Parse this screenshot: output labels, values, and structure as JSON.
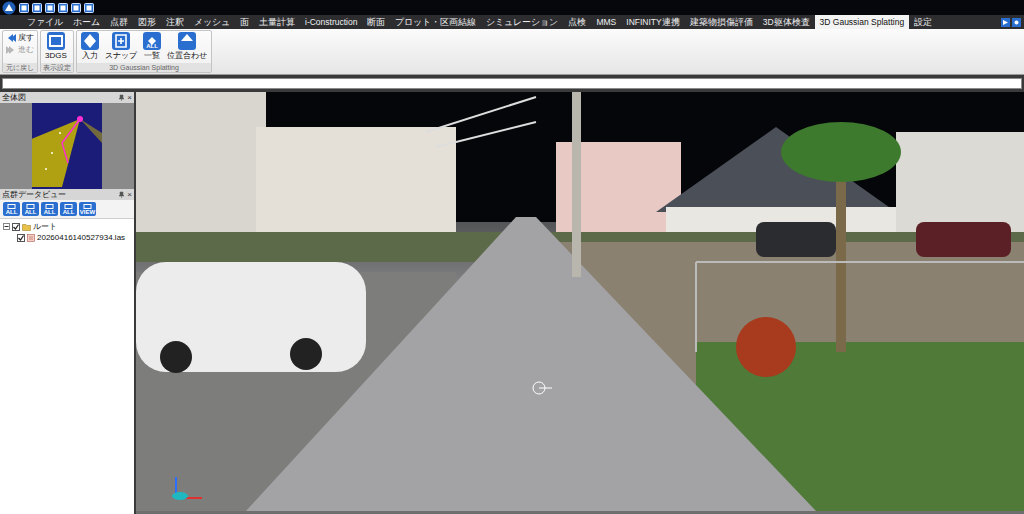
{
  "menu_tabs": [
    {
      "label": "ファイル",
      "selected": false
    },
    {
      "label": "ホーム",
      "selected": false
    },
    {
      "label": "点群",
      "selected": false
    },
    {
      "label": "図形",
      "selected": false
    },
    {
      "label": "注釈",
      "selected": false
    },
    {
      "label": "メッシュ",
      "selected": false
    },
    {
      "label": "面",
      "selected": false
    },
    {
      "label": "土量計算",
      "selected": false
    },
    {
      "label": "i-Construction",
      "selected": false
    },
    {
      "label": "断面",
      "selected": false
    },
    {
      "label": "プロット・区画結線",
      "selected": false
    },
    {
      "label": "シミュレーション",
      "selected": false
    },
    {
      "label": "点検",
      "selected": false
    },
    {
      "label": "MMS",
      "selected": false
    },
    {
      "label": "INFINITY連携",
      "selected": false
    },
    {
      "label": "建築物損傷評価",
      "selected": false
    },
    {
      "label": "3D躯体検査",
      "selected": false
    },
    {
      "label": "3D Gaussian Splatting",
      "selected": true
    },
    {
      "label": "設定",
      "selected": false
    }
  ],
  "ribbon": {
    "groups": [
      {
        "label": "元に戻し",
        "buttons": [
          {
            "label": "戻す",
            "disabled": false
          },
          {
            "label": "進む",
            "disabled": true
          }
        ]
      },
      {
        "label": "表示設定",
        "buttons": [
          {
            "label": "3DGS",
            "disabled": false
          }
        ]
      },
      {
        "label": "3D Gaussian Splatting",
        "buttons": [
          {
            "label": "入力",
            "disabled": false
          },
          {
            "label": "スナップ",
            "disabled": false
          },
          {
            "label": "一覧",
            "disabled": false,
            "badge": "ALL"
          },
          {
            "label": "位置合わせ",
            "disabled": false
          }
        ]
      }
    ]
  },
  "overview_panel": {
    "title": "全体図",
    "close": "×"
  },
  "data_view_panel": {
    "title": "点群データビュー",
    "close": "×",
    "toolbar": [
      "ALL",
      "ALL",
      "ALL",
      "ALL",
      "VIEW"
    ],
    "tree": {
      "label": "ルート",
      "checked": true,
      "expanded": true,
      "children": [
        {
          "label": "20260416140527934.las",
          "checked": true
        }
      ]
    }
  }
}
